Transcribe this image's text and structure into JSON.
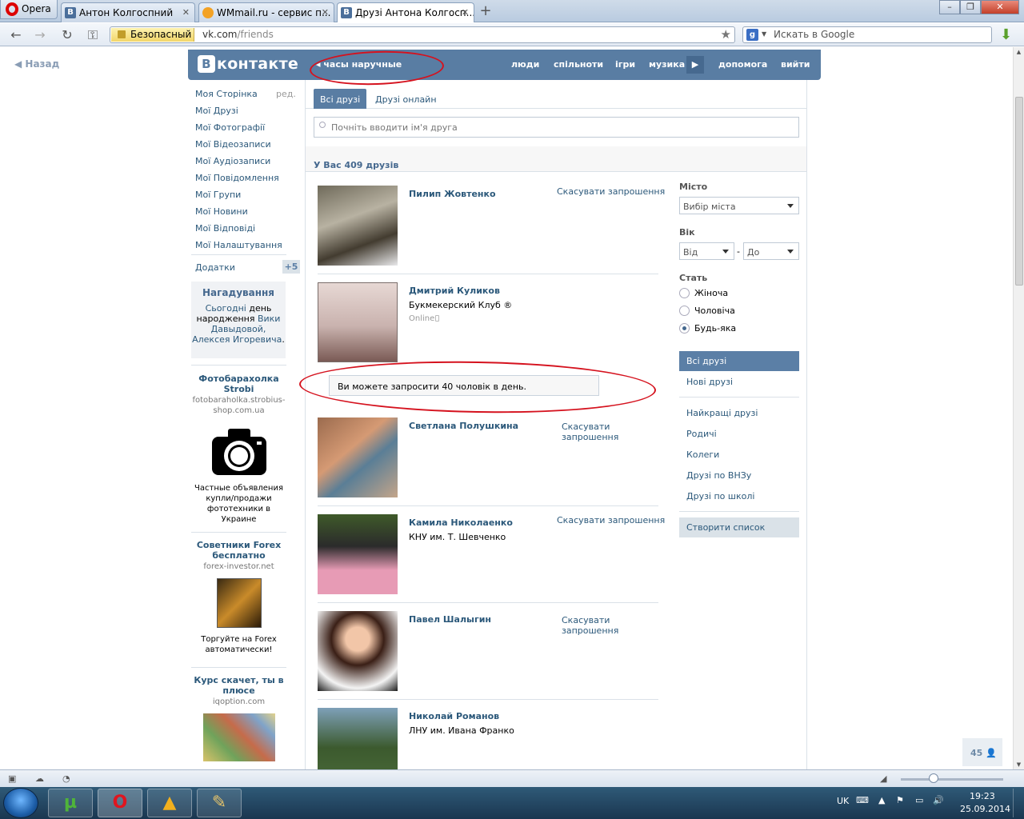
{
  "browser": {
    "menu_label": "Opera",
    "tabs": [
      {
        "label": "Антон Колгоспний",
        "fav": "B"
      },
      {
        "label": "WMmail.ru - сервис п...",
        "fav": ""
      },
      {
        "label": "Друзі Антона Колгосп...",
        "fav": "B"
      }
    ],
    "window_controls": [
      "–",
      "❐",
      "✕"
    ],
    "secure_label": "Безопасный",
    "url_host": "vk.com",
    "url_path": "/friends",
    "search_placeholder": "Искать в Google"
  },
  "page": {
    "back_label": "Назад",
    "header": {
      "logo_letter": "В",
      "logo_text": "контакте",
      "status": "часы наручные",
      "nav": [
        "люди",
        "спільноти",
        "ігри",
        "музика",
        "допомога",
        "вийти"
      ]
    },
    "sidebar": {
      "items": [
        "Моя Сторінка",
        "Мої Друзі",
        "Мої Фотографії",
        "Мої Відеозаписи",
        "Мої Аудіозаписи",
        "Мої Повідомлення",
        "Мої Групи",
        "Мої Новини",
        "Мої Відповіді",
        "Мої Налаштування"
      ],
      "edit_label": "ред.",
      "apps_label": "Додатки",
      "apps_badge": "+5",
      "reminder": {
        "title": "Нагадування",
        "today": "Сьогодні",
        "text1": " день народження ",
        "name": "Вики Давыдовой, Алексея Игоревича",
        "dot": "."
      },
      "ads": [
        {
          "title": "Фотобарахолка Strobi",
          "url": "fotobaraholka.strobius-shop.com.ua",
          "desc": "Частные объявления купли/продажи фототехники в Украине"
        },
        {
          "title": "Советники Forex бесплатно",
          "url": "forex-investor.net",
          "desc": "Торгуйте на Forex автоматически!"
        },
        {
          "title": "Курс скачет, ты в плюсе",
          "url": "iqoption.com",
          "desc": ""
        }
      ]
    },
    "friends": {
      "tabs": [
        "Всі друзі",
        "Друзі онлайн"
      ],
      "search_placeholder": "Почніть вводити ім'я друга",
      "count_label": "У Вас 409 друзів",
      "list": [
        {
          "name": "Пилип Жовтенко",
          "sub": "",
          "online": "",
          "action": "Скасувати запрошення"
        },
        {
          "name": "Дмитрий Куликов",
          "sub": "Букмекерский Клуб ®",
          "online": "Online",
          "action": ""
        },
        {
          "name": "Светлана Полушкина",
          "sub": "",
          "online": "",
          "action": "Скасувати запрошення"
        },
        {
          "name": "Камила Николаенко",
          "sub": "КНУ им. Т. Шевченко",
          "online": "",
          "action": "Скасувати запрошення"
        },
        {
          "name": "Павел Шалыгин",
          "sub": "",
          "online": "",
          "action": "Скасувати запрошення"
        },
        {
          "name": "Николай Романов",
          "sub": "ЛНУ им. Ивана Франко",
          "online": "",
          "action": ""
        }
      ],
      "notice": "Ви можете запросити 40 чоловік в день."
    },
    "filter": {
      "city_label": "Місто",
      "city_value": "Вибір міста",
      "age_label": "Вік",
      "age_from": "Від",
      "age_dash": "-",
      "age_to": "До",
      "sex_label": "Стать",
      "sex_options": [
        "Жіноча",
        "Чоловіча",
        "Будь-яка"
      ],
      "sex_selected": "Будь-яка",
      "menu": [
        "Всі друзі",
        "Нові друзі",
        "Найкращі друзі",
        "Родичі",
        "Колеги",
        "Друзі по ВНЗу",
        "Друзі по школі"
      ],
      "create_list": "Створити список"
    },
    "online_counter": "45"
  },
  "taskbar": {
    "lang": "UK",
    "time": "19:23",
    "date": "25.09.2014"
  },
  "colors": {
    "vk_blue": "#597da3",
    "link": "#2b587a",
    "annotation_red": "#d5121e"
  }
}
